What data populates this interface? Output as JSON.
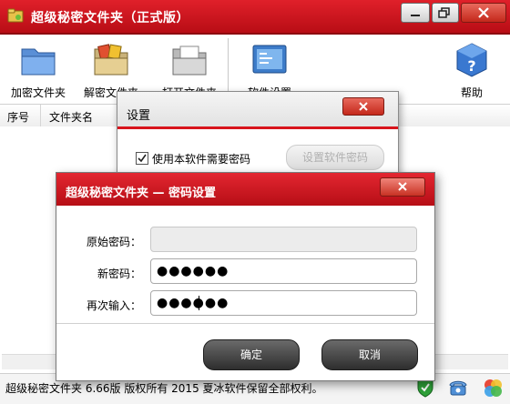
{
  "window": {
    "title": "超级秘密文件夹（正式版）"
  },
  "toolbar": {
    "encrypt": "加密文件夹",
    "decrypt": "解密文件夹",
    "open": "打开文件夹",
    "settings": "软件设置",
    "help": "帮助"
  },
  "list": {
    "columns": [
      "序号",
      "文件夹名"
    ]
  },
  "status": {
    "text": "超级秘密文件夹 6.66版 版权所有 2015 夏冰软件保留全部权利。"
  },
  "settings_dialog": {
    "title": "设置",
    "require_password_label": "使用本软件需要密码",
    "require_password_checked": true,
    "set_password_button": "设置软件密码"
  },
  "password_dialog": {
    "title": "超级秘密文件夹 — 密码设置",
    "fields": [
      {
        "label": "原始密码：",
        "value": "",
        "disabled": true
      },
      {
        "label": "新密码：",
        "value": "●●●●●●",
        "disabled": false
      },
      {
        "label": "再次输入：",
        "value": "●●●●●●",
        "disabled": false
      }
    ],
    "ok_button": "确定",
    "cancel_button": "取消"
  },
  "colors": {
    "accent": "#d8141c",
    "title_bar": "#c8141c"
  }
}
